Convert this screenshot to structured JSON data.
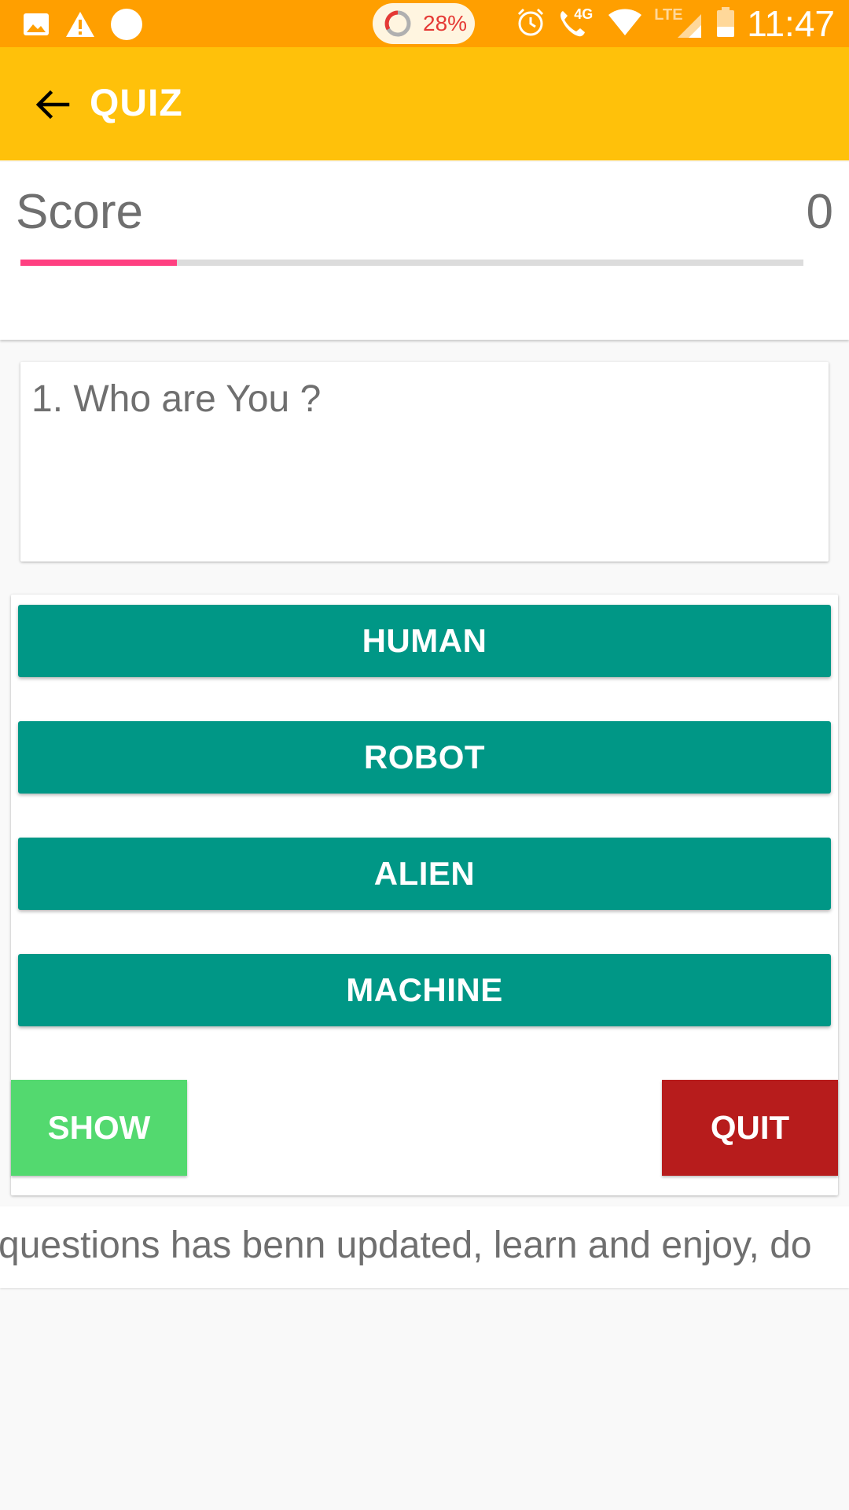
{
  "status_bar": {
    "battery_saver_percent": "28%",
    "network_label": "4G",
    "lte_label": "LTE",
    "time": "11:47",
    "icons": [
      "image-icon",
      "warning-icon",
      "circle-icon",
      "battery-ring-icon",
      "alarm-icon",
      "wifi-call-icon",
      "wifi-icon",
      "signal-icon",
      "battery-icon"
    ]
  },
  "app_bar": {
    "title": "QUIZ",
    "back_icon": "arrow-back-icon",
    "color": "#ffc10a"
  },
  "score": {
    "label": "Score",
    "value": "0",
    "progress": 0.2,
    "progress_color": "#ff4081"
  },
  "question": {
    "text": "1. Who are You ?"
  },
  "answers": [
    {
      "label": "HUMAN"
    },
    {
      "label": "ROBOT"
    },
    {
      "label": "ALIEN"
    },
    {
      "label": "MACHINE"
    }
  ],
  "actions": {
    "show_label": "SHOW",
    "quit_label": "QUIT",
    "show_color": "#53d96f",
    "quit_color": "#b71c1c"
  },
  "ticker": {
    "text": "questions has benn updated, learn and enjoy, do"
  },
  "colors": {
    "answer_button": "#009786",
    "status_bar": "#ff9f00"
  }
}
